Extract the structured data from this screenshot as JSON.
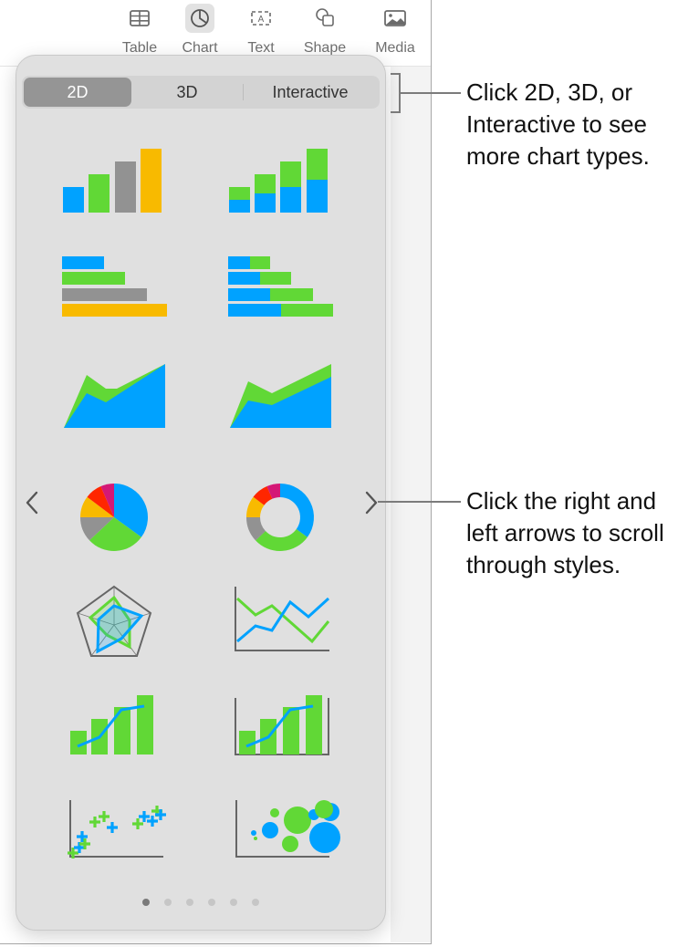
{
  "toolbar": {
    "items": [
      {
        "label": "Table",
        "icon": "table-icon"
      },
      {
        "label": "Chart",
        "icon": "chart-icon",
        "active": true
      },
      {
        "label": "Text",
        "icon": "text-box-icon"
      },
      {
        "label": "Shape",
        "icon": "shape-icon"
      },
      {
        "label": "Media",
        "icon": "media-icon"
      }
    ]
  },
  "chart_picker": {
    "segments": [
      {
        "label": "2D",
        "selected": true
      },
      {
        "label": "3D",
        "selected": false
      },
      {
        "label": "Interactive",
        "selected": false
      }
    ],
    "chart_types": [
      "column",
      "stacked-column",
      "bar",
      "stacked-bar",
      "area",
      "stacked-area",
      "pie",
      "donut",
      "radar",
      "line",
      "mixed",
      "two-axis",
      "scatter",
      "bubble"
    ],
    "page_dots": {
      "count": 6,
      "current": 1
    },
    "nav": {
      "left": "chevron-left-icon",
      "right": "chevron-right-icon"
    },
    "colors": {
      "blue": "#00a2ff",
      "green": "#61d836",
      "gray": "#929292",
      "yellow": "#f8ba00",
      "red": "#ff2600",
      "magenta": "#d41876"
    }
  },
  "callouts": {
    "segments": "Click 2D, 3D, or Interactive to see more chart types.",
    "segments_lines": [
      "Click 2D, 3D, or",
      "Interactive to see",
      "more chart types."
    ],
    "arrows_lines": [
      "Click the right and",
      "left arrows to scroll",
      "through styles."
    ]
  }
}
